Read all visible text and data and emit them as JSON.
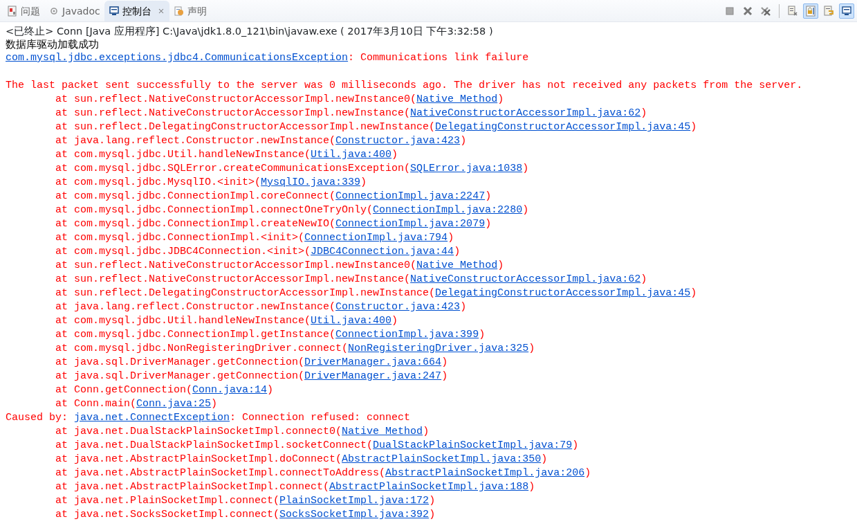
{
  "tabs": [
    {
      "kind": "problems",
      "label": "问题",
      "selected": false,
      "closable": false
    },
    {
      "kind": "javadoc",
      "label": "Javadoc",
      "selected": false,
      "closable": false
    },
    {
      "kind": "console",
      "label": "控制台",
      "selected": true,
      "closable": true
    },
    {
      "kind": "declaration",
      "label": "声明",
      "selected": false,
      "closable": false
    }
  ],
  "toolbar": [
    {
      "kind": "stop"
    },
    {
      "kind": "remove"
    },
    {
      "kind": "remove-all"
    },
    {
      "kind": "separator"
    },
    {
      "kind": "clear"
    },
    {
      "kind": "scroll-lock",
      "pressed": true
    },
    {
      "kind": "word-wrap"
    },
    {
      "kind": "display",
      "pressed": true
    }
  ],
  "header": "<已终止> Conn [Java 应用程序] C:\\Java\\jdk1.8.0_121\\bin\\javaw.exe ( 2017年3月10日 下午3:32:58 )",
  "lines": [
    {
      "kind": "out",
      "text": "数据库驱动加载成功"
    },
    {
      "kind": "err",
      "link": "com.mysql.jdbc.exceptions.jdbc4.CommunicationsException",
      "after": ": Communications link failure"
    },
    {
      "kind": "blank"
    },
    {
      "kind": "err",
      "text": "The last packet sent successfully to the server was 0 milliseconds ago. The driver has not received any packets from the server."
    },
    {
      "kind": "err",
      "text": "\tat sun.reflect.NativeConstructorAccessorImpl.newInstance0(",
      "link": "Native Method",
      "after": ")"
    },
    {
      "kind": "err",
      "text": "\tat sun.reflect.NativeConstructorAccessorImpl.newInstance(",
      "link": "NativeConstructorAccessorImpl.java:62",
      "after": ")"
    },
    {
      "kind": "err",
      "text": "\tat sun.reflect.DelegatingConstructorAccessorImpl.newInstance(",
      "link": "DelegatingConstructorAccessorImpl.java:45",
      "after": ")"
    },
    {
      "kind": "err",
      "text": "\tat java.lang.reflect.Constructor.newInstance(",
      "link": "Constructor.java:423",
      "after": ")"
    },
    {
      "kind": "err",
      "text": "\tat com.mysql.jdbc.Util.handleNewInstance(",
      "link": "Util.java:400",
      "after": ")"
    },
    {
      "kind": "err",
      "text": "\tat com.mysql.jdbc.SQLError.createCommunicationsException(",
      "link": "SQLError.java:1038",
      "after": ")"
    },
    {
      "kind": "err",
      "text": "\tat com.mysql.jdbc.MysqlIO.<init>(",
      "link": "MysqlIO.java:339",
      "after": ")"
    },
    {
      "kind": "err",
      "text": "\tat com.mysql.jdbc.ConnectionImpl.coreConnect(",
      "link": "ConnectionImpl.java:2247",
      "after": ")"
    },
    {
      "kind": "err",
      "text": "\tat com.mysql.jdbc.ConnectionImpl.connectOneTryOnly(",
      "link": "ConnectionImpl.java:2280",
      "after": ")"
    },
    {
      "kind": "err",
      "text": "\tat com.mysql.jdbc.ConnectionImpl.createNewIO(",
      "link": "ConnectionImpl.java:2079",
      "after": ")"
    },
    {
      "kind": "err",
      "text": "\tat com.mysql.jdbc.ConnectionImpl.<init>(",
      "link": "ConnectionImpl.java:794",
      "after": ")"
    },
    {
      "kind": "err",
      "text": "\tat com.mysql.jdbc.JDBC4Connection.<init>(",
      "link": "JDBC4Connection.java:44",
      "after": ")"
    },
    {
      "kind": "err",
      "text": "\tat sun.reflect.NativeConstructorAccessorImpl.newInstance0(",
      "link": "Native Method",
      "after": ")"
    },
    {
      "kind": "err",
      "text": "\tat sun.reflect.NativeConstructorAccessorImpl.newInstance(",
      "link": "NativeConstructorAccessorImpl.java:62",
      "after": ")"
    },
    {
      "kind": "err",
      "text": "\tat sun.reflect.DelegatingConstructorAccessorImpl.newInstance(",
      "link": "DelegatingConstructorAccessorImpl.java:45",
      "after": ")"
    },
    {
      "kind": "err",
      "text": "\tat java.lang.reflect.Constructor.newInstance(",
      "link": "Constructor.java:423",
      "after": ")"
    },
    {
      "kind": "err",
      "text": "\tat com.mysql.jdbc.Util.handleNewInstance(",
      "link": "Util.java:400",
      "after": ")"
    },
    {
      "kind": "err",
      "text": "\tat com.mysql.jdbc.ConnectionImpl.getInstance(",
      "link": "ConnectionImpl.java:399",
      "after": ")"
    },
    {
      "kind": "err",
      "text": "\tat com.mysql.jdbc.NonRegisteringDriver.connect(",
      "link": "NonRegisteringDriver.java:325",
      "after": ")"
    },
    {
      "kind": "err",
      "text": "\tat java.sql.DriverManager.getConnection(",
      "link": "DriverManager.java:664",
      "after": ")"
    },
    {
      "kind": "err",
      "text": "\tat java.sql.DriverManager.getConnection(",
      "link": "DriverManager.java:247",
      "after": ")"
    },
    {
      "kind": "err",
      "text": "\tat Conn.getConnection(",
      "link": "Conn.java:14",
      "after": ")"
    },
    {
      "kind": "err",
      "text": "\tat Conn.main(",
      "link": "Conn.java:25",
      "after": ")"
    },
    {
      "kind": "err",
      "text": "Caused by: ",
      "link": "java.net.ConnectException",
      "after": ": Connection refused: connect"
    },
    {
      "kind": "err",
      "text": "\tat java.net.DualStackPlainSocketImpl.connect0(",
      "link": "Native Method",
      "after": ")"
    },
    {
      "kind": "err",
      "text": "\tat java.net.DualStackPlainSocketImpl.socketConnect(",
      "link": "DualStackPlainSocketImpl.java:79",
      "after": ")"
    },
    {
      "kind": "err",
      "text": "\tat java.net.AbstractPlainSocketImpl.doConnect(",
      "link": "AbstractPlainSocketImpl.java:350",
      "after": ")"
    },
    {
      "kind": "err",
      "text": "\tat java.net.AbstractPlainSocketImpl.connectToAddress(",
      "link": "AbstractPlainSocketImpl.java:206",
      "after": ")"
    },
    {
      "kind": "err",
      "text": "\tat java.net.AbstractPlainSocketImpl.connect(",
      "link": "AbstractPlainSocketImpl.java:188",
      "after": ")"
    },
    {
      "kind": "err",
      "text": "\tat java.net.PlainSocketImpl.connect(",
      "link": "PlainSocketImpl.java:172",
      "after": ")"
    },
    {
      "kind": "err",
      "text": "\tat java.net.SocksSocketImpl.connect(",
      "link": "SocksSocketImpl.java:392",
      "after": ")"
    }
  ]
}
